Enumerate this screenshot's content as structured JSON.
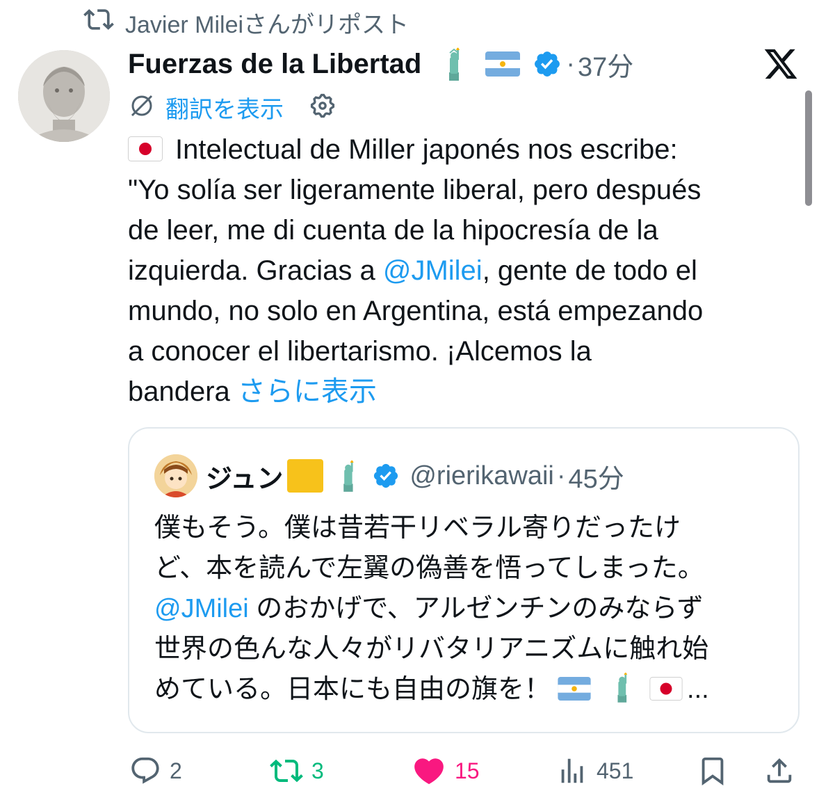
{
  "repost_banner": {
    "text": "Javier Mileiさんがリポスト"
  },
  "tweet": {
    "author_name": "Fuerzas de la Libertad",
    "time": "37分",
    "separator": "·",
    "translate_label": "翻訳を表示",
    "text_lines": [
      "Intelectual de Miller japonés nos escribe:",
      "\"Yo solía ser ligeramente liberal, pero después",
      "de leer, me di cuenta de la hipocresía de la"
    ],
    "line4_before": "izquierda. Gracias a ",
    "line4_mention": "@JMilei",
    "line4_after": ", gente de todo el",
    "line5": "mundo, no solo en Argentina, está empezando",
    "line6": "a conocer el libertarismo. ¡Alcemos la",
    "line7_before": "bandera ",
    "show_more": "さらに表示"
  },
  "quote": {
    "author_name": "ジュン",
    "handle": "@rierikawaii",
    "separator": "·",
    "time": "45分",
    "line1": "僕もそう。僕は昔若干リベラル寄りだったけ",
    "line2": "ど、本を読んで左翼の偽善を悟ってしまった。",
    "line3_mention": "@JMilei",
    "line3_after": " のおかげで、アルゼンチンのみならず",
    "line4": "世界の色んな人々がリバタリアニズムに触れ始",
    "line5_before": "めている。日本にも自由の旗を！",
    "ellipsis": "..."
  },
  "actions": {
    "replies": "2",
    "reposts": "3",
    "likes": "15",
    "views": "451"
  },
  "colors": {
    "link": "#1d9bf0",
    "muted": "#536471",
    "repost_green": "#00ba7c",
    "like_pink": "#f91880",
    "verified_blue": "#1d9bf0"
  }
}
